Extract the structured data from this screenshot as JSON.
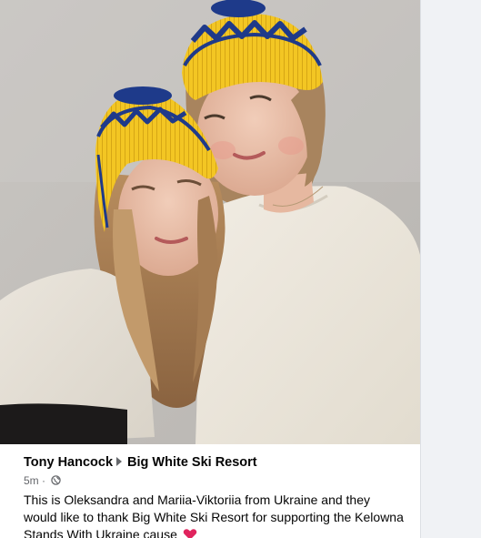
{
  "post": {
    "author": "Tony Hancock",
    "target_page": "Big White Ski Resort",
    "timestamp": "5m",
    "separator": "·",
    "privacy_icon": "globe-icon",
    "text": "This is Oleksandra and Mariia-Viktoriia from Ukraine and they would like to thank Big White Ski Resort for supporting the Kelowna Stands With Ukraine cause",
    "emoji_icon": "red-heart-icon"
  },
  "colors": {
    "hat_yellow": "#f3c623",
    "hat_blue": "#1f3a8a",
    "heart_red": "#e0245e"
  }
}
